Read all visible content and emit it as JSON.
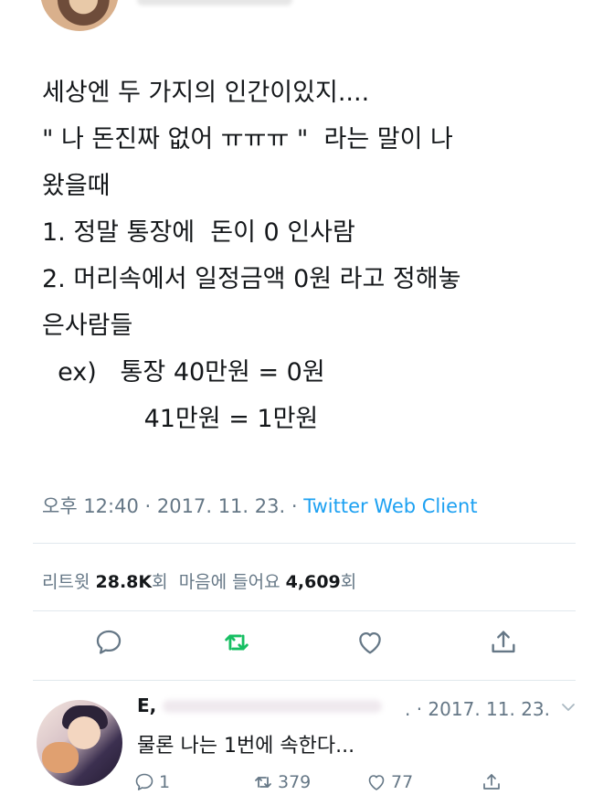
{
  "tweet": {
    "lines": [
      "세상엔 두 가지의 인간이있지....",
      "\" 나 돈진짜 없어 ㅠㅠㅠ \"  라는 말이 나",
      "왔을때",
      "1. 정말 통장에  돈이 0 인사람",
      "2. 머리속에서 일정금액 0원 라고 정해놓",
      "은사람들",
      "  ex)   통장 40만원 = 0원",
      "             41만원 = 1만원"
    ]
  },
  "meta": {
    "time": "오후 12:40",
    "date": "2017. 11. 23.",
    "separator": "·",
    "client": "Twitter Web Client"
  },
  "stats": {
    "retweet_label": "리트윗",
    "retweet_count": "28.8K",
    "retweet_unit": "회",
    "like_label": "마음에 들어요",
    "like_count": "4,609",
    "like_unit": "회"
  },
  "actions": [
    "reply-icon",
    "retweet-icon",
    "like-icon",
    "share-icon"
  ],
  "colors": {
    "link": "#1da1f2",
    "retweet": "#17bf63",
    "muted": "#657786"
  },
  "reply": {
    "name": "E,",
    "date": ". · 2017. 11. 23.",
    "text": "물론 나는 1번에 속한다...",
    "reply_count": "1",
    "retweet_count": "379",
    "like_count": "77"
  }
}
